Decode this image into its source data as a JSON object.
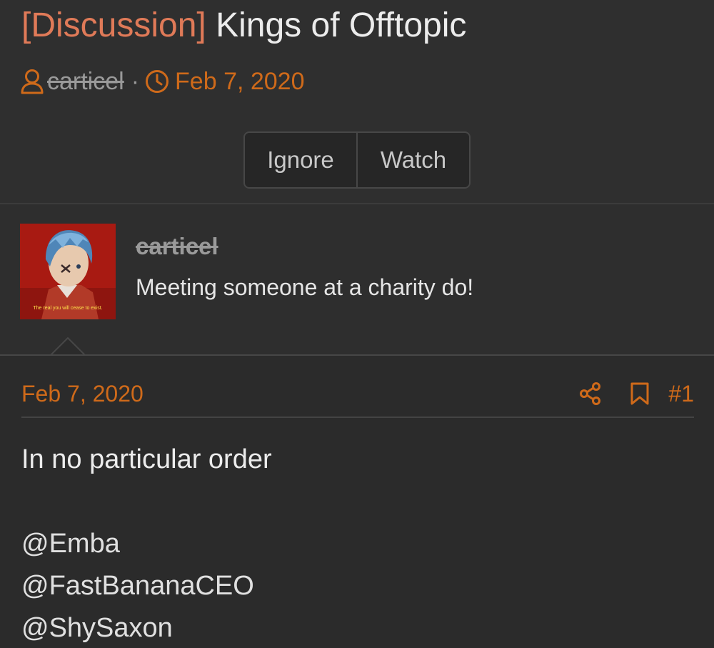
{
  "thread": {
    "prefix": "[Discussion]",
    "title": "Kings of Offtopic",
    "author": "carticel",
    "separator": "·",
    "date": "Feb 7, 2020",
    "buttons": {
      "ignore": "Ignore",
      "watch": "Watch"
    }
  },
  "post": {
    "user": {
      "name": "carticel",
      "title": "Meeting someone at a charity do!",
      "avatar_caption": "The real you will cease to exist."
    },
    "date": "Feb 7, 2020",
    "number": "#1",
    "body": {
      "intro": "In no particular order",
      "mentions": [
        "@Emba",
        "@FastBananaCEO",
        "@ShySaxon"
      ]
    }
  },
  "colors": {
    "background": "#2b2b2b",
    "accent": "#cf6a1a",
    "prefix": "#e07a58",
    "text": "#ececec",
    "muted": "#9a9a9a"
  },
  "icons": [
    "user-icon",
    "clock-icon",
    "share-icon",
    "bookmark-icon"
  ]
}
